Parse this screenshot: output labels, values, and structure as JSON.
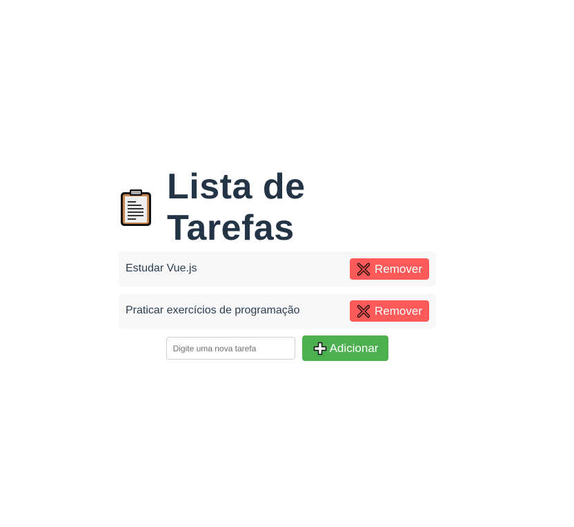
{
  "header": {
    "title": "Lista de Tarefas",
    "icon": "clipboard-icon"
  },
  "tasks": [
    {
      "text": "Estudar Vue.js",
      "remove_label": "Remover"
    },
    {
      "text": "Praticar exercícios de programação",
      "remove_label": "Remover"
    }
  ],
  "add_form": {
    "input_value": "",
    "placeholder": "Digite uma nova tarefa",
    "add_label": "Adicionar"
  },
  "colors": {
    "title": "#233447",
    "remove_button": "#ff5a5a",
    "add_button": "#4caf50",
    "task_background": "#f8f8f8"
  }
}
